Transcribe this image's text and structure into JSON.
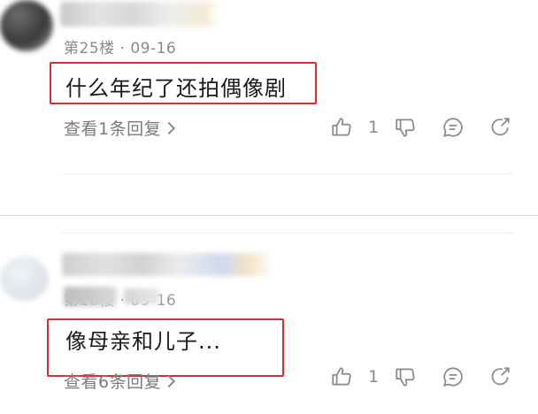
{
  "comments": [
    {
      "floor_date": "第25楼 · 09-16",
      "text": "什么年纪了还拍偶像剧",
      "replies_label": "查看1条回复",
      "like_count": "1"
    },
    {
      "floor_date": "第18楼 · 09-16",
      "text": "像母亲和儿子...",
      "replies_label": "查看6条回复",
      "like_count": "1"
    }
  ],
  "icons": {
    "like": "thumbs-up-icon",
    "dislike": "thumbs-down-icon",
    "comment": "comment-bubble-icon",
    "share": "share-icon"
  },
  "colors": {
    "highlight_box": "#e02a2a",
    "meta_text": "#8a8a8a"
  }
}
